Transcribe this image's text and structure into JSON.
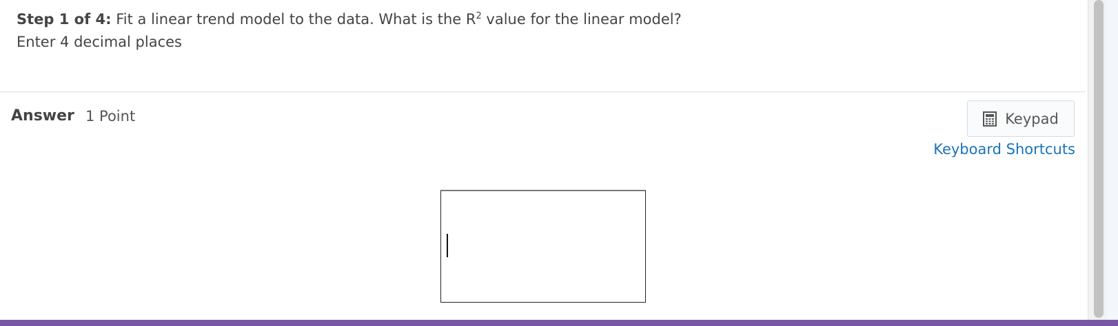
{
  "question": {
    "step_label": "Step 1 of 4:",
    "text_before": "Fit a linear trend model to the data. What is the R",
    "superscript": "2",
    "text_after": " value for the linear model?",
    "instruction": "Enter 4 decimal places"
  },
  "answer": {
    "label": "Answer",
    "points": "1 Point",
    "input_value": ""
  },
  "toolbar": {
    "keypad_label": "Keypad",
    "keypad_icon": "calculator-icon",
    "shortcuts_label": "Keyboard Shortcuts"
  },
  "colors": {
    "text": "#444444",
    "link": "#1a73b8",
    "bottom_bar": "#7a56a6"
  }
}
